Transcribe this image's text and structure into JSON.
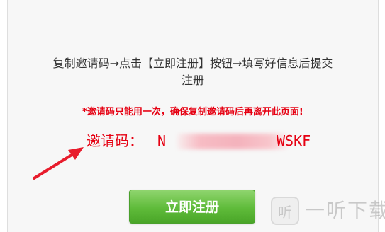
{
  "instruction": {
    "line1": "复制邀请码→点击【立即注册】按钮→填写好信息后提交",
    "line2": "注册"
  },
  "warning": "*邀请码只能用一次，确保复制邀请码后再离开此页面!",
  "invite_code": {
    "label": "邀请码：",
    "visible_start": "N",
    "visible_end": "WSKF"
  },
  "register_button_label": "立即注册",
  "watermark": {
    "icon_text": "听",
    "text": "一听下载"
  },
  "colors": {
    "accent_red": "#e60012",
    "button_green": "#5fbb3a",
    "text_gray": "#333333"
  }
}
